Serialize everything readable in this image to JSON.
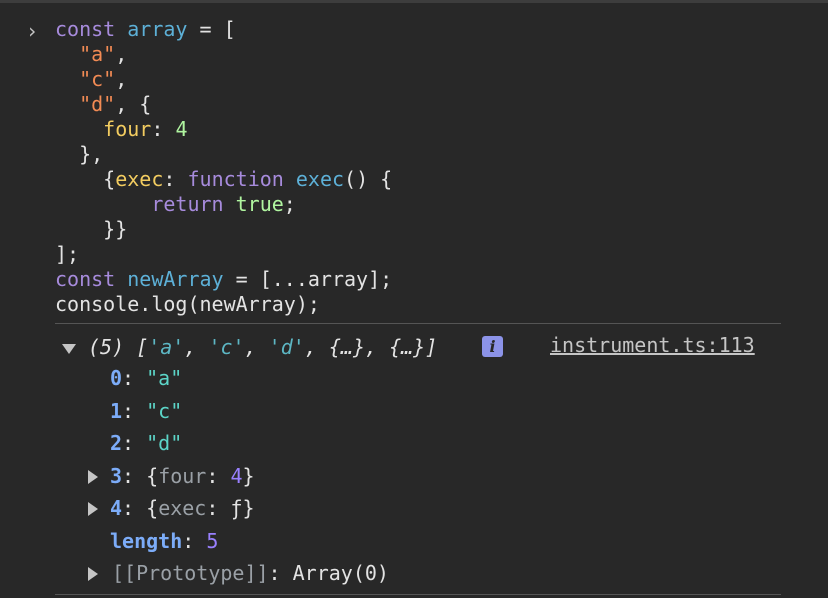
{
  "input": {
    "prompt_glyph": "›",
    "lines": [
      [
        {
          "t": "const",
          "c": "kw"
        },
        {
          "t": " ",
          "c": "plain"
        },
        {
          "t": "array",
          "c": "var"
        },
        {
          "t": " = [",
          "c": "plain"
        }
      ],
      [
        {
          "t": "  ",
          "c": "plain"
        },
        {
          "t": "\"a\"",
          "c": "str"
        },
        {
          "t": ",",
          "c": "plain"
        }
      ],
      [
        {
          "t": "  ",
          "c": "plain"
        },
        {
          "t": "\"c\"",
          "c": "str"
        },
        {
          "t": ",",
          "c": "plain"
        }
      ],
      [
        {
          "t": "  ",
          "c": "plain"
        },
        {
          "t": "\"d\"",
          "c": "str"
        },
        {
          "t": ", {",
          "c": "plain"
        }
      ],
      [
        {
          "t": "    ",
          "c": "plain"
        },
        {
          "t": "four",
          "c": "prop"
        },
        {
          "t": ": ",
          "c": "plain"
        },
        {
          "t": "4",
          "c": "num"
        }
      ],
      [
        {
          "t": "  },",
          "c": "plain"
        }
      ],
      [
        {
          "t": "    {",
          "c": "plain"
        },
        {
          "t": "exec",
          "c": "prop"
        },
        {
          "t": ": ",
          "c": "plain"
        },
        {
          "t": "function",
          "c": "kw"
        },
        {
          "t": " ",
          "c": "plain"
        },
        {
          "t": "exec",
          "c": "fn"
        },
        {
          "t": "() {",
          "c": "plain"
        }
      ],
      [
        {
          "t": "        ",
          "c": "plain"
        },
        {
          "t": "return",
          "c": "kw"
        },
        {
          "t": " ",
          "c": "plain"
        },
        {
          "t": "true",
          "c": "bool"
        },
        {
          "t": ";",
          "c": "plain"
        }
      ],
      [
        {
          "t": "    }}",
          "c": "plain"
        }
      ],
      [
        {
          "t": "];",
          "c": "plain"
        }
      ],
      [
        {
          "t": "const",
          "c": "kw"
        },
        {
          "t": " ",
          "c": "plain"
        },
        {
          "t": "newArray",
          "c": "var"
        },
        {
          "t": " = [...array];",
          "c": "plain"
        }
      ],
      [
        {
          "t": "console.log(newArray);",
          "c": "plain"
        }
      ]
    ]
  },
  "output": {
    "summary_parts": [
      {
        "t": "(5) [",
        "c": "summary"
      },
      {
        "t": "'a'",
        "c": "sum-str"
      },
      {
        "t": ", ",
        "c": "summary"
      },
      {
        "t": "'c'",
        "c": "sum-str"
      },
      {
        "t": ", ",
        "c": "summary"
      },
      {
        "t": "'d'",
        "c": "sum-str"
      },
      {
        "t": ", {…}, {…}]",
        "c": "summary"
      }
    ],
    "info_badge": "i",
    "source_link": "instrument.ts:113",
    "rows": [
      {
        "key": "0",
        "sep": ": ",
        "value": "\"a\"",
        "vclass": "val-str",
        "expandable": false
      },
      {
        "key": "1",
        "sep": ": ",
        "value": "\"c\"",
        "vclass": "val-str",
        "expandable": false
      },
      {
        "key": "2",
        "sep": ": ",
        "value": "\"d\"",
        "vclass": "val-str",
        "expandable": false
      },
      {
        "key": "3",
        "sep": ": ",
        "value_parts": [
          {
            "t": "{",
            "c": "plain"
          },
          {
            "t": "four",
            "c": "dim"
          },
          {
            "t": ": ",
            "c": "plain"
          },
          {
            "t": "4",
            "c": "val-num"
          },
          {
            "t": "}",
            "c": "plain"
          }
        ],
        "expandable": true
      },
      {
        "key": "4",
        "sep": ": ",
        "value_parts": [
          {
            "t": "{",
            "c": "plain"
          },
          {
            "t": "exec",
            "c": "dim"
          },
          {
            "t": ": ",
            "c": "plain"
          },
          {
            "t": "ƒ",
            "c": "plain"
          },
          {
            "t": "}",
            "c": "plain"
          }
        ],
        "expandable": true
      },
      {
        "key": "length",
        "sep": ": ",
        "value": "5",
        "vclass": "val-num",
        "expandable": false,
        "dimkey": true
      },
      {
        "key": "[[Prototype]]",
        "sep": ": ",
        "value": "Array(0)",
        "vclass": "plain",
        "expandable": true,
        "dimkey": true,
        "plainkey": true
      }
    ]
  }
}
